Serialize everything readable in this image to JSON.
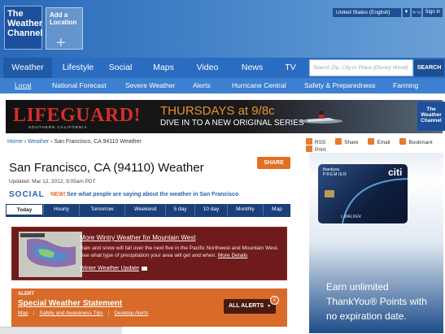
{
  "header": {
    "logo": [
      "The",
      "Weather",
      "Channel"
    ],
    "add_location": "Add a Location",
    "locale": "United States (English)",
    "units": "°F °C",
    "sign_in": "Sign In"
  },
  "nav": {
    "items": [
      "Weather",
      "Lifestyle",
      "Social",
      "Maps",
      "Video",
      "News",
      "TV"
    ],
    "search_placeholder": "Search Zip, City or Place (Disney World)",
    "search_button": "SEARCH"
  },
  "subnav": {
    "items": [
      "Local",
      "National Forecast",
      "Severe Weather",
      "Alerts",
      "Hurricane Central",
      "Safety & Preparedness",
      "Farming"
    ]
  },
  "banner": {
    "brand": "LIFEGUARD!",
    "brand_sub": "SOUTHERN CALIFORNIA",
    "line1": "THURSDAYS at 9/8c",
    "line2": "DIVE IN TO A NEW ORIGINAL SERIES",
    "logo_text": [
      "The",
      "Weather",
      "Channel"
    ]
  },
  "breadcrumb": {
    "home": "Home",
    "weather": "Weather",
    "current": "San Francisco, CA 94110 Weather",
    "sep": "›"
  },
  "tools": {
    "items": [
      "RSS",
      "Share",
      "Email",
      "Bookmark",
      "Print"
    ]
  },
  "page": {
    "title": "San Francisco, CA (94110) Weather",
    "updated": "Updated: Mar 12, 2012, 9:05am PDT",
    "share_button": "SHARE",
    "social_word": "SOCIAL",
    "social_new": "NEW!",
    "social_message": "See what people are saying about the weather in San Francisco"
  },
  "tabs": {
    "items": [
      "Today",
      "Hourly",
      "Tomorrow",
      "Weekend",
      "5 day",
      "10 day",
      "Monthly",
      "Map"
    ],
    "active": "Today"
  },
  "wintry": {
    "title": "More Wintry Weather for Mountain West",
    "body": "Rain and snow will fall over the next five in the Pacific Northwest and Mountain West. See what type of precipitation your area will get and when.",
    "more": "More Details",
    "video_link": "Winter Weather Update"
  },
  "alert": {
    "tag": "ALERT",
    "title": "Special Weather Statement",
    "links": [
      "Map",
      "Safety and Awareness Tips",
      "Desktop Alerts"
    ],
    "all_alerts": "ALL ALERTS",
    "count": "2"
  },
  "side_ad": {
    "card_issuer": [
      "thankyou",
      "PREMIER"
    ],
    "card_brand": "citi",
    "card_holder": "L WALKER",
    "line1": "Earn unlimited",
    "line2": "ThankYou® Points with",
    "line3": "no expiration date."
  },
  "colors": {
    "nav_blue": "#2a6cc2",
    "subnav_blue": "#3d7fd0",
    "accent_orange": "#e36f24",
    "wintry_red": "#6f1b1b",
    "alert_orange": "#d86a2a"
  }
}
